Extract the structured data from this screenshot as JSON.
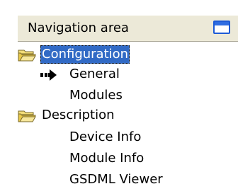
{
  "header": {
    "title": "Navigation area"
  },
  "icons": {
    "window": "window-icon",
    "folder": "open-folder-icon",
    "current": "right-arrow-icon"
  },
  "tree": {
    "configuration": {
      "label": "Configuration",
      "selected": true,
      "children": {
        "general": {
          "label": "General",
          "current": true
        },
        "modules": {
          "label": "Modules"
        }
      }
    },
    "description": {
      "label": "Description",
      "children": {
        "device_info": {
          "label": "Device Info"
        },
        "module_info": {
          "label": "Module Info"
        },
        "gsdml_viewer": {
          "label": "GSDML Viewer"
        }
      }
    }
  },
  "colors": {
    "selection_bg": "#316ac5",
    "selection_text": "#ffffff",
    "header_bg": "#ece9d8",
    "window_icon": "#1e5bd6",
    "folder": "#e8c84a"
  }
}
